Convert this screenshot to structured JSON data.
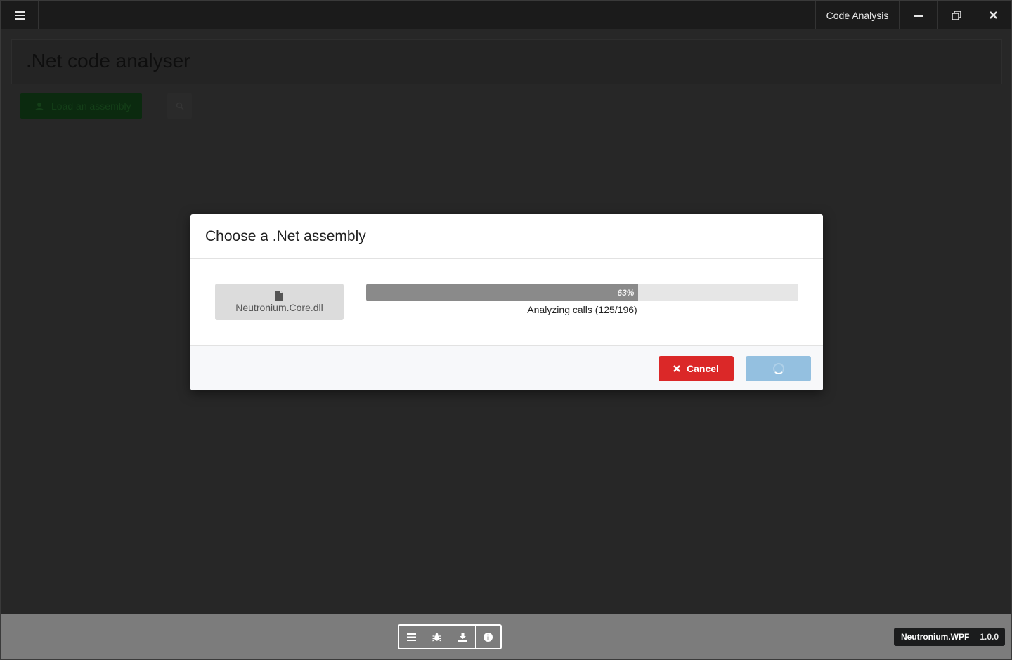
{
  "titlebar": {
    "menu_icon": "hamburger-icon",
    "title": "Code Analysis",
    "buttons": [
      "minimize-icon",
      "restore-icon",
      "close-icon"
    ]
  },
  "page": {
    "title": ".Net code analyser",
    "load_button_label": "Load an assembly",
    "load_button_icon": "upload-user-icon",
    "search_button_icon": "search-icon"
  },
  "modal": {
    "title": "Choose a .Net assembly",
    "file": {
      "icon": "file-icon",
      "name": "Neutronium.Core.dll"
    },
    "progress": {
      "percent": 63,
      "percent_label": "63%",
      "status": "Analyzing calls (125/196)"
    },
    "cancel_label": "Cancel",
    "ok_loading": true,
    "colors": {
      "cancel": "#db2828",
      "ok": "#94c0e0",
      "progress_fill": "#8a8a8a"
    }
  },
  "statusbar": {
    "tools": [
      "list-icon",
      "bug-icon",
      "download-icon",
      "info-icon"
    ],
    "framework": "Neutronium.WPF",
    "version": "1.0.0"
  }
}
